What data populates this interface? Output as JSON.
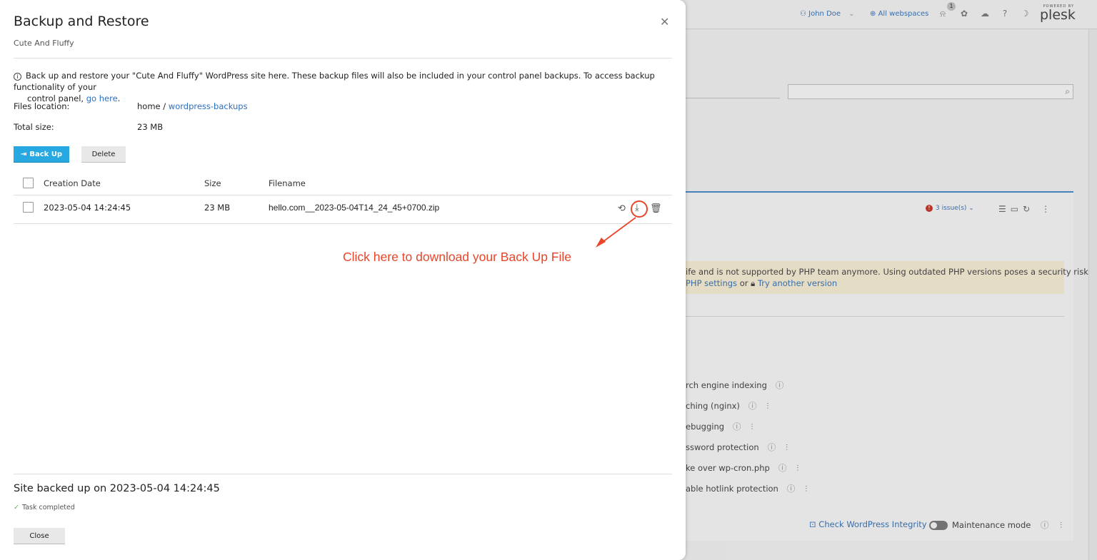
{
  "background": {
    "user_name": "John Doe",
    "user_chevron": "⌄",
    "webspaces": "All webspaces",
    "notification_count": "1",
    "logo_powered": "POWERED BY",
    "logo_name": "plesk",
    "issues": "3 issue(s)",
    "issues_chevron": "⌄",
    "php_warning_line1": "ife and is not supported by PHP team anymore. Using outdated PHP versions poses a security risk",
    "php_settings_link": "PHP settings",
    "php_or": "or",
    "try_version_link": "Try another version",
    "options": [
      "rch engine indexing",
      "ching (nginx)",
      "ebugging",
      "ssword protection",
      "ke over wp-cron.php",
      "able hotlink protection"
    ],
    "check_integrity": "Check WordPress Integrity",
    "maintenance_mode": "Maintenance mode"
  },
  "modal": {
    "title": "Backup and Restore",
    "subtitle": "Cute And Fluffy",
    "info_line1": "Back up and restore your \"Cute And Fluffy\" WordPress site here. These backup files will also be included in your control panel backups. To access backup functionality of your",
    "info_line2_prefix": "control panel,",
    "info_link": "go here",
    "info_line2_suffix": ".",
    "files_location_label": "Files location:",
    "files_location_home": "home /",
    "files_location_folder": "wordpress-backups",
    "total_size_label": "Total size:",
    "total_size_value": "23 MB",
    "backup_button": "Back Up",
    "delete_button": "Delete",
    "columns": [
      "Creation Date",
      "Size",
      "Filename"
    ],
    "rows": [
      {
        "date": "2023-05-04 14:24:45",
        "size": "23 MB",
        "filename": "hello.com__2023-05-04T14_24_45+0700.zip"
      }
    ],
    "annotation": "Click here to download your Back Up File",
    "status_title": "Site backed up on 2023-05-04 14:24:45",
    "status_sub": "Task completed",
    "close_button": "Close"
  },
  "colors": {
    "primary": "#28a8e0",
    "link": "#2a6fc4",
    "annotation": "#e8452a",
    "success": "#6aa84f"
  }
}
